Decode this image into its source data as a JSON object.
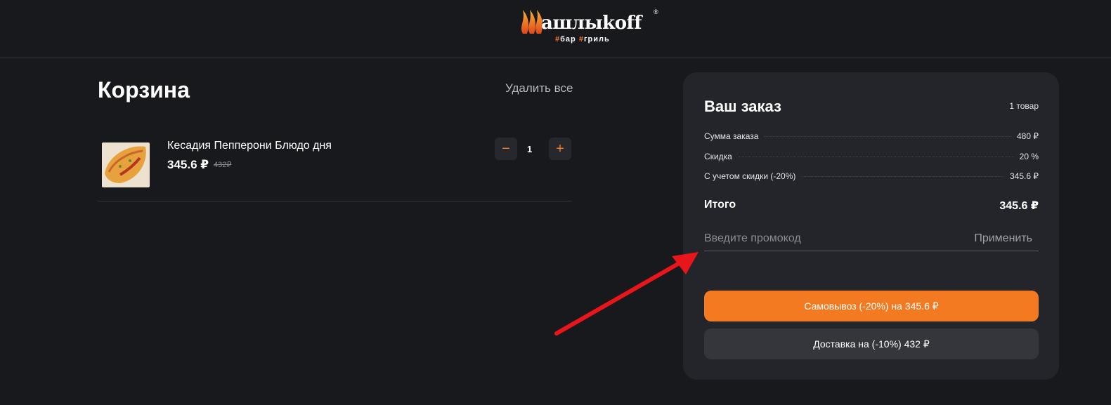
{
  "logo": {
    "word": "ашлыkoff",
    "registered": "®",
    "tag_hash1": "#",
    "tag_word1": "бар ",
    "tag_hash2": "#",
    "tag_word2": "гриль"
  },
  "cart": {
    "title": "Корзина",
    "clear_all": "Удалить все",
    "items": [
      {
        "name": "Кесадия Пепперони Блюдо дня",
        "price": "345.6 ₽",
        "old_price": "432₽",
        "quantity": "1",
        "minus": "−",
        "plus": "+"
      }
    ]
  },
  "order": {
    "title": "Ваш заказ",
    "count": "1 товар",
    "rows": [
      {
        "label": "Сумма заказа",
        "value": "480 ₽"
      },
      {
        "label": "Скидка",
        "value": "20 %"
      },
      {
        "label": "С учетом скидки (-20%)",
        "value": "345.6 ₽"
      }
    ],
    "total_label": "Итого",
    "total_value": "345.6 ₽",
    "promo_placeholder": "Введите промокод",
    "promo_apply": "Применить",
    "pickup_button": "Самовывоз (-20%) на 345.6 ₽",
    "delivery_button": "Доставка на (-10%) 432 ₽"
  },
  "colors": {
    "background": "#18191d",
    "panel": "#23252a",
    "accent": "#f47a21",
    "annotation_arrow": "#e8161b"
  }
}
